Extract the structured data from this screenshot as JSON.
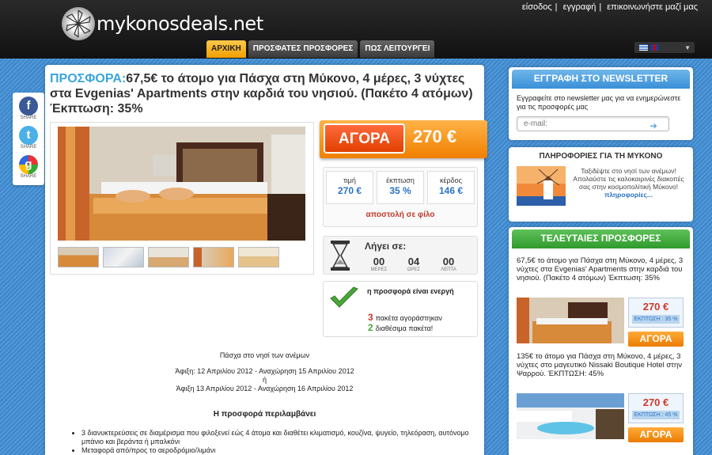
{
  "header": {
    "logo_text": "mykonosdeals.net",
    "top_links": [
      "είσοδος",
      "εγγραφή",
      "επικοινωνήστε μαζί μας"
    ],
    "nav": [
      "ΑΡΧΙΚΗ",
      "ΠΡΟΣΦΑΤΕΣ ΠΡΟΣΦΟΡΕΣ",
      "ΠΩΣ ΛΕΙΤΟΥΡΓΕΙ"
    ],
    "active_nav": "ΑΡΧΙΚΗ",
    "languages": [
      "gr-flag-icon",
      "en-flag-icon"
    ]
  },
  "share": [
    {
      "icon": "facebook-icon",
      "glyph": "f",
      "label": "SHARE"
    },
    {
      "icon": "twitter-icon",
      "glyph": "t",
      "label": "SHARE"
    },
    {
      "icon": "google-buzz-icon",
      "glyph": "g",
      "label": "SHARE"
    }
  ],
  "offer": {
    "title_prefix": "ΠΡΟΣΦΟΡΑ:",
    "title": "67,5€ το άτομο για Πάσχα στη Μύκονο, 4 μέρες, 3 νύχτες στα Evgenias' Apartments στην καρδιά του νησιού. (Πακέτο 4 ατόμων) Έκπτωση: 35%",
    "buy_label": "ΑΓΟΡΑ",
    "buy_price": "270 €",
    "stats": [
      {
        "label": "τιμή",
        "value": "270 €"
      },
      {
        "label": "έκπτωση",
        "value": "35 %"
      },
      {
        "label": "κέρδος",
        "value": "146 €"
      }
    ],
    "send_to_friend": "αποστολή σε φίλο",
    "timer_title": "Λήγει σε:",
    "timer": [
      {
        "value": "00",
        "unit": "ΜΕΡΕΣ"
      },
      {
        "value": "04",
        "unit": "ΩΡΕΣ"
      },
      {
        "value": "00",
        "unit": "ΛΕΠΤΑ"
      }
    ],
    "active_text": "η προσφορά είναι ενεργή",
    "bought_count": "3",
    "bought_text": "πακέτα αγοράστηκαν",
    "available_count": "2",
    "available_text": "διαθέσιμα πακέτα!",
    "description": {
      "heading": "Πάσχα στο νησί των ανέμων",
      "line1": "Άφιξη: 12 Απριλίου 2012 - Αναχώρηση 15 Απριλίου 2012",
      "or": "ή",
      "line2": "Άφιξη 13 Απριλίου 2012 - Αναχώρηση 16 Απριλίου 2012",
      "includes": "Η προσφορά περιλαμβάνει",
      "bullets": [
        "3 διανυκτερεύσεις σε διαμέρισμα που φιλοξενεί εώς 4 άτομα και διαθέτει κλιματισμό, κουζίνα, ψυγείο, τηλεόραση, αυτόνομο μπάνιο και βεράντα ή μπαλκόνι",
        "Μεταφορά από/προς το αεροδρόμιο/λιμάνι"
      ]
    }
  },
  "newsletter": {
    "title": "ΕΓΓΡΑΦΗ ΣΤΟ NEWSLETTER",
    "text": "Εγγραφείτε στο newsletter μας για να ενημερώνεστε για τις προσφορές μας",
    "placeholder": "e-mail:"
  },
  "info": {
    "title": "ΠΛΗΡΟΦΟΡΙΕΣ ΓΙΑ ΤΗ ΜΥΚΟΝΟ",
    "text": "Ταξιδέψτε στο νησί των ανέμων! Απολαύστε τις καλοκαιρινές διακοπές σας στην κοσμοπολίτική Μύκονο!",
    "link": "πληροφορίες..."
  },
  "latest": {
    "title": "ΤΕΛΕΥΤΑΙΕΣ ΠΡΟΣΦΟΡΕΣ",
    "deals": [
      {
        "title": "67,5€ το άτομο για Πάσχα στη Μύκονο, 4 μέρες, 3 νύχτες στα Evgenias' Apartments στην καρδιά του νησιού. (Πακέτο 4 ατόμων) Έκπτωση: 35%",
        "price": "270 €",
        "discount": "ΕΚΠΤΩΣΗ : 35 %",
        "buy": "ΑΓΟΡΑ"
      },
      {
        "title": "135€ το άτομο για Πάσχα στη Μύκονο, 4 μέρες, 3 νύχτες στο μαγευτικό Nissaki Boutique Hotel στην Ψαρρού. ΈΚΠΤΩΣΗ: 45%",
        "price": "270 €",
        "discount": "ΕΚΠΤΩΣΗ : 45 %",
        "buy": "ΑΓΟΡΑ"
      }
    ]
  },
  "colors": {
    "accent_blue": "#3aa5de",
    "buy_orange": "#f07f00",
    "green": "#2f9a2c"
  }
}
